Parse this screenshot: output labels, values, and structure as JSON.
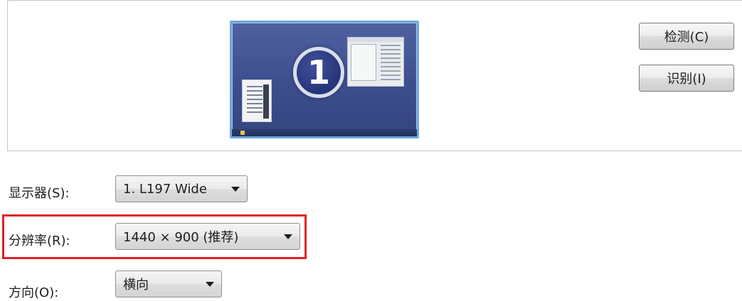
{
  "preview": {
    "display_number": "1"
  },
  "buttons": {
    "detect_label": "检测(C)",
    "identify_label": "识别(I)"
  },
  "settings": {
    "display": {
      "label": "显示器(S):",
      "value": "1. L197 Wide"
    },
    "resolution": {
      "label": "分辨率(R):",
      "value": "1440 × 900 (推荐)"
    },
    "orientation": {
      "label": "方向(O):",
      "value": "横向"
    }
  },
  "colors": {
    "highlight": "#e41e26",
    "monitor_border": "#6ea6dc",
    "desktop": "#3d4e8e"
  }
}
